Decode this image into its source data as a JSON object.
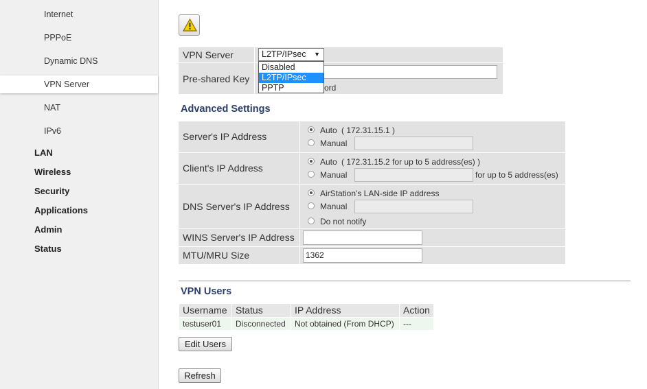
{
  "sidebar": {
    "sub_items": [
      "Internet",
      "PPPoE",
      "Dynamic DNS",
      "VPN Server",
      "NAT",
      "IPv6"
    ],
    "main_items": [
      "LAN",
      "Wireless",
      "Security",
      "Applications",
      "Admin",
      "Status"
    ]
  },
  "vpn": {
    "server_label": "VPN Server",
    "server_value": "L2TP/IPsec",
    "server_options": [
      "Disabled",
      "L2TP/IPsec",
      "PPTP"
    ],
    "psk_label": "Pre-shared Key",
    "psk_hint_tail": "ord"
  },
  "advanced": {
    "title": "Advanced Settings",
    "server_ip_label": "Server's IP Address",
    "server_ip_auto": "Auto",
    "server_ip_auto_value": "( 172.31.15.1 )",
    "server_ip_manual": "Manual",
    "client_ip_label": "Client's IP Address",
    "client_ip_auto": "Auto",
    "client_ip_auto_value": "( 172.31.15.2 for up to 5 address(es) )",
    "client_ip_manual": "Manual",
    "client_ip_suffix": "for up to 5 address(es)",
    "dns_label": "DNS Server's IP Address",
    "dns_lan": "AirStation's LAN-side IP address",
    "dns_manual": "Manual",
    "dns_none": "Do not notify",
    "wins_label": "WINS Server's IP Address",
    "wins_value": "",
    "mtu_label": "MTU/MRU Size",
    "mtu_value": "1362"
  },
  "users": {
    "title": "VPN Users",
    "headers": [
      "Username",
      "Status",
      "IP Address",
      "Action"
    ],
    "rows": [
      [
        "testuser01",
        "Disconnected",
        "Not obtained (From DHCP)",
        "---"
      ]
    ],
    "edit_button": "Edit Users",
    "refresh_button": "Refresh"
  },
  "icons": {
    "warning": "warning-icon",
    "dropdown_arrow": "triangle-down-icon"
  },
  "colors": {
    "section_title": "#2c3f6b",
    "selected_option": "#1e90ff",
    "users_row_bg": "#eef7ee"
  }
}
